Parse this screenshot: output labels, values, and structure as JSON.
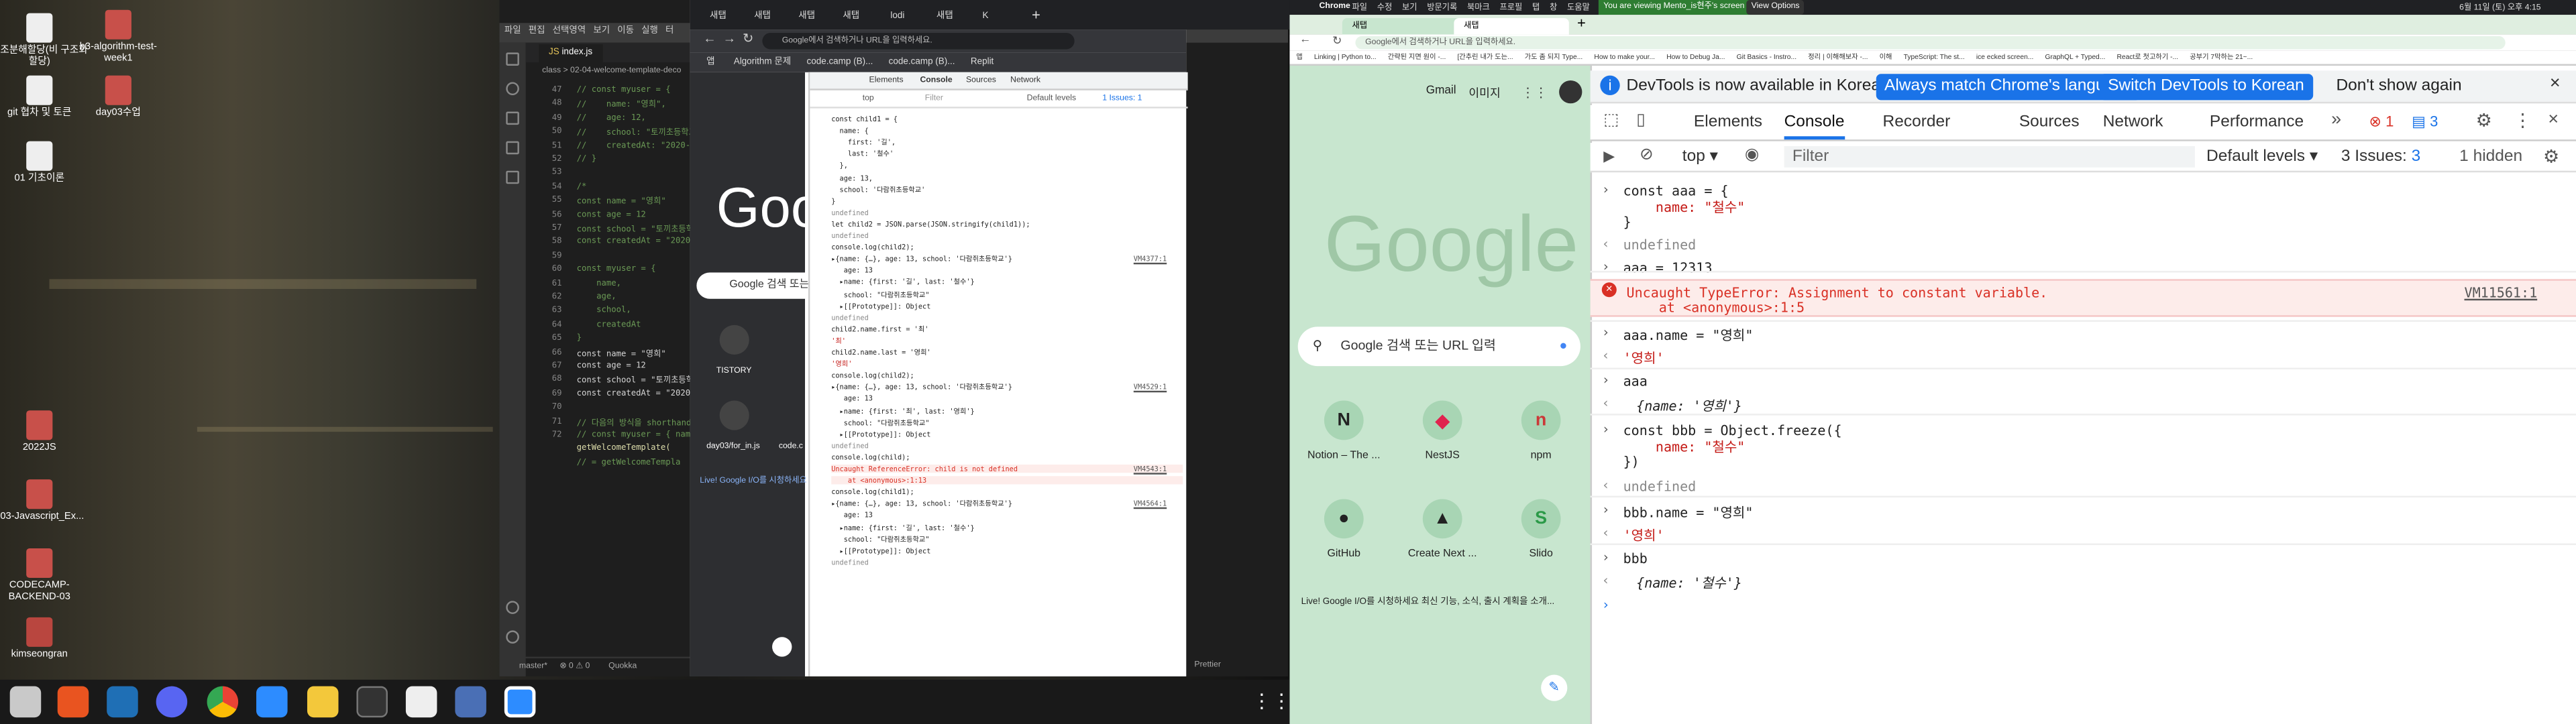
{
  "desktop": {
    "icons": [
      {
        "label": "구조분해할당(비 구조화할당)",
        "kind": "file"
      },
      {
        "label": "b3-algorithm-test-week1",
        "kind": "folder"
      },
      {
        "label": "git 협차 및 토큰",
        "kind": "file"
      },
      {
        "label": "day03수업",
        "kind": "folder"
      },
      {
        "label": "01 기초이론",
        "kind": "file"
      },
      {
        "label": "2022JS",
        "kind": "folder"
      },
      {
        "label": "b03-Javascript_Ex...",
        "kind": "folder"
      },
      {
        "label": "CODECAMP-BACKEND-03",
        "kind": "folder"
      },
      {
        "label": "kimseongran",
        "kind": "home"
      }
    ]
  },
  "topbar": {
    "app": "Chrome",
    "menu": [
      "파일",
      "수정",
      "보기",
      "방문기록",
      "북마크",
      "프로필",
      "탭",
      "창",
      "도움말"
    ],
    "banner": "You are viewing Mento_is현주's screen",
    "view_options": "View Options",
    "clock": "6월 11일 (토) 오후 4:15"
  },
  "vscode": {
    "menu": [
      "파일",
      "편집",
      "선택영역",
      "보기",
      "이동",
      "실행",
      "터"
    ],
    "tab": "index.js",
    "breadcrumb": "class > 02-04-welcome-template-deco",
    "line_numbers": [
      "47",
      "48",
      "49",
      "50",
      "51",
      "52",
      "53",
      "54",
      "55",
      "56",
      "57",
      "58",
      "59",
      "60",
      "61",
      "62",
      "63",
      "64",
      "65",
      "66",
      "67",
      "68",
      "69",
      "70",
      "71",
      "72"
    ],
    "code_lines": [
      "// const myuser = {",
      "//    name: \"영희\",",
      "//    age: 12,",
      "//    school: \"토끼초등학교\",",
      "//    createdAt: \"2020-01-\"",
      "// }",
      "",
      "/*",
      "const name = \"영희\"",
      "const age = 12",
      "const school = \"토끼초등학",
      "const createdAt = \"2020-0",
      "",
      "const myuser = {",
      "    name,",
      "    age,",
      "    school,",
      "    createdAt",
      "}",
      "const name = \"영희\"",
      "const age = 12",
      "const school = \"토끼초등학",
      "const createdAt = \"2020-0",
      "",
      "// 다음의 방식을 shorthand",
      "// const myuser = { name,"
    ],
    "code_tail": [
      "getWelcomeTemplate(",
      "// = getWelcomeTempla"
    ],
    "status_left": "master*",
    "status_mid": "⊗ 0 ⚠ 0",
    "status_right": "Quokka",
    "status_prettier": "Prettier"
  },
  "left_chrome": {
    "tabs": [
      "새탭",
      "새탭",
      "새탭",
      "새탭",
      "lodi",
      "새탭",
      "K"
    ],
    "omnibox": "Google에서 검색하거나 URL을 입력하세요.",
    "bookmarks": [
      "앱",
      "Algorithm 문제",
      "code.camp (B)...",
      "code.camp (B)...",
      "Replit"
    ],
    "page_logo": "Goo",
    "search_placeholder": "Google 검색 또는",
    "shortcut_1": "TISTORY",
    "shortcut_2": "day03/for_in.js",
    "shortcut_3": "code.c",
    "live_text": "Live! Google I/O를 시청하세요",
    "devtools": {
      "tabs": [
        "Elements",
        "Console",
        "Sources",
        "Network"
      ],
      "filter_top": "top",
      "filter_placeholder": "Filter",
      "levels": "Default levels",
      "issues": "1 Issues: 1",
      "lines": [
        "const child1 = {",
        "  name: {",
        "    first: '길',",
        "    last: '철수'",
        "  },",
        "  age: 13,",
        "  school: '다람쥐초등학교'",
        "}",
        "undefined",
        "let child2 = JSON.parse(JSON.stringify(child1));",
        "undefined",
        "console.log(child2);",
        "▸{name: {…}, age: 13, school: '다람쥐초등학교'}",
        "   age: 13",
        "  ▸name: {first: '길', last: '철수'}",
        "   school: \"다람쥐초등학교\"",
        "  ▸[[Prototype]]: Object",
        "undefined",
        "child2.name.first = '최'",
        "'최'",
        "child2.name.last = '영희'",
        "'영희'",
        "console.log(child2);",
        "▸{name: {…}, age: 13, school: '다람쥐초등학교'}",
        "   age: 13",
        "  ▸name: {first: '최', last: '영희'}",
        "   school: \"다람쥐초등학교\"",
        "  ▸[[Prototype]]: Object",
        "undefined",
        "console.log(child);",
        "Uncaught ReferenceError: child is not defined",
        "    at <anonymous>:1:13",
        "console.log(child1);",
        "▸{name: {…}, age: 13, school: '다람쥐초등학교'}",
        "   age: 13",
        "  ▸name: {first: '길', last: '철수'}",
        "   school: \"다람쥐초등학교\"",
        "  ▸[[Prototype]]: Object",
        "undefined"
      ],
      "vm_refs": [
        "VM4377:1",
        "VM4529:1",
        "VM4543:1",
        "VM4564:1"
      ]
    }
  },
  "right_chrome": {
    "tabs": [
      "새탭",
      "새탭"
    ],
    "omnibox": "Google에서 검색하거나 URL을 입력하세요.",
    "bookmarks": [
      "앱",
      "Linking | Python to...",
      "간략된 지면 원이 -...",
      "[간추린 내가 도는...",
      "가도 좀 되지 Type...",
      "How to make your...",
      "How to Debug Ja...",
      "Git Basics - Instro...",
      "정리 | 이해해보자 -...",
      "이해",
      "TypeScript: The st...",
      "ice ecked screen...",
      "GraphQL + Typed...",
      "React로 첫고하기 -...",
      "공부기 7막하는 21~..."
    ],
    "gmail": "Gmail",
    "images": "이미지",
    "logo": "Google",
    "search_placeholder": "Google 검색 또는 URL 입력",
    "shortcuts": [
      {
        "label": "Notion – The ...",
        "glyph": "N"
      },
      {
        "label": "NestJS",
        "glyph": "◆"
      },
      {
        "label": "npm",
        "glyph": "n"
      },
      {
        "label": "GitHub",
        "glyph": "●"
      },
      {
        "label": "Create Next ...",
        "glyph": "▲"
      },
      {
        "label": "Slido",
        "glyph": "S"
      }
    ],
    "live_text": "Live! Google I/O를 시청하세요 최신 기능, 소식, 출시 계획을 소개...",
    "devtools": {
      "banner": "DevTools is now available in Korean!",
      "btn_match": "Always match Chrome's language",
      "btn_switch": "Switch DevTools to Korean",
      "btn_dismiss": "Don't show again",
      "tabs": [
        "Elements",
        "Console",
        "Recorder",
        "Sources",
        "Network",
        "Performance"
      ],
      "error_count": "1",
      "msg_count": "3",
      "context": "top",
      "filter_placeholder": "Filter",
      "levels": "Default levels",
      "issues": "3 Issues:",
      "issues_count": "3",
      "hidden": "1 hidden",
      "error_ref": "VM11561:1",
      "lines": {
        "l1": "const aaa = {",
        "l2": "    name: \"철수\"",
        "l3": "}",
        "l4": "undefined",
        "l5": "aaa = 12313",
        "l6": "Uncaught TypeError: Assignment to constant variable.",
        "l7": "    at <anonymous>:1:5",
        "l8": "aaa.name = \"영희\"",
        "l9": "'영희'",
        "l10": "aaa",
        "l11": "{name: '영희'}",
        "l12": "const bbb = Object.freeze({",
        "l13": "    name: \"철수\"",
        "l14": "})",
        "l15": "undefined",
        "l16": "bbb.name = \"영희\"",
        "l17": "'영희'",
        "l18": "bbb",
        "l19": "{name: '철수'}"
      }
    }
  }
}
